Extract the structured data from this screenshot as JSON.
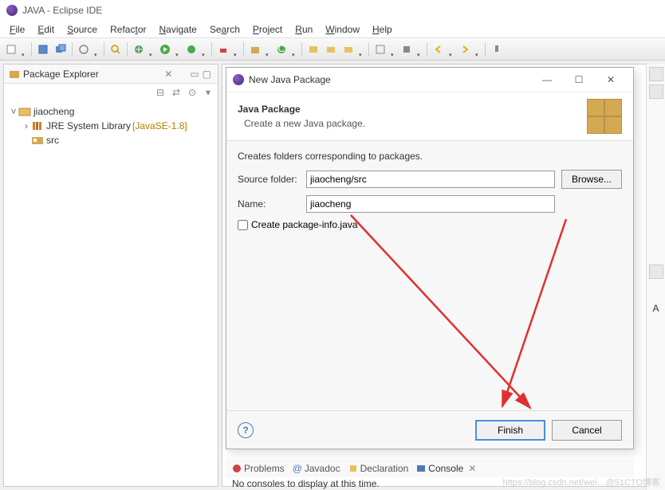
{
  "window": {
    "title": "JAVA - Eclipse IDE"
  },
  "menu": {
    "file": "File",
    "edit": "Edit",
    "source": "Source",
    "refactor": "Refactor",
    "navigate": "Navigate",
    "search": "Search",
    "project": "Project",
    "run": "Run",
    "window": "Window",
    "help": "Help"
  },
  "packageExplorer": {
    "title": "Package Explorer",
    "project": "jiaocheng",
    "jre": "JRE System Library",
    "jreDecoration": "[JavaSE-1.8]",
    "src": "src"
  },
  "dialog": {
    "title": "New Java Package",
    "bannerHeading": "Java Package",
    "bannerDesc": "Create a new Java package.",
    "bodyHint": "Creates folders corresponding to packages.",
    "sourceFolderLabel": "Source folder:",
    "sourceFolderValue": "jiaocheng/src",
    "browseLabel": "Browse...",
    "nameLabel": "Name:",
    "nameValue": "jiaocheng",
    "createPkgInfoLabel": "Create package-info.java",
    "finishLabel": "Finish",
    "cancelLabel": "Cancel"
  },
  "bottomTabs": {
    "problems": "Problems",
    "javadoc": "Javadoc",
    "declaration": "Declaration",
    "console": "Console"
  },
  "console": {
    "message": "No consoles to display at this time."
  },
  "watermark": "https://blog.csdn.net/wei…@51CTO博客",
  "rightStrip": {
    "letter": "A"
  }
}
